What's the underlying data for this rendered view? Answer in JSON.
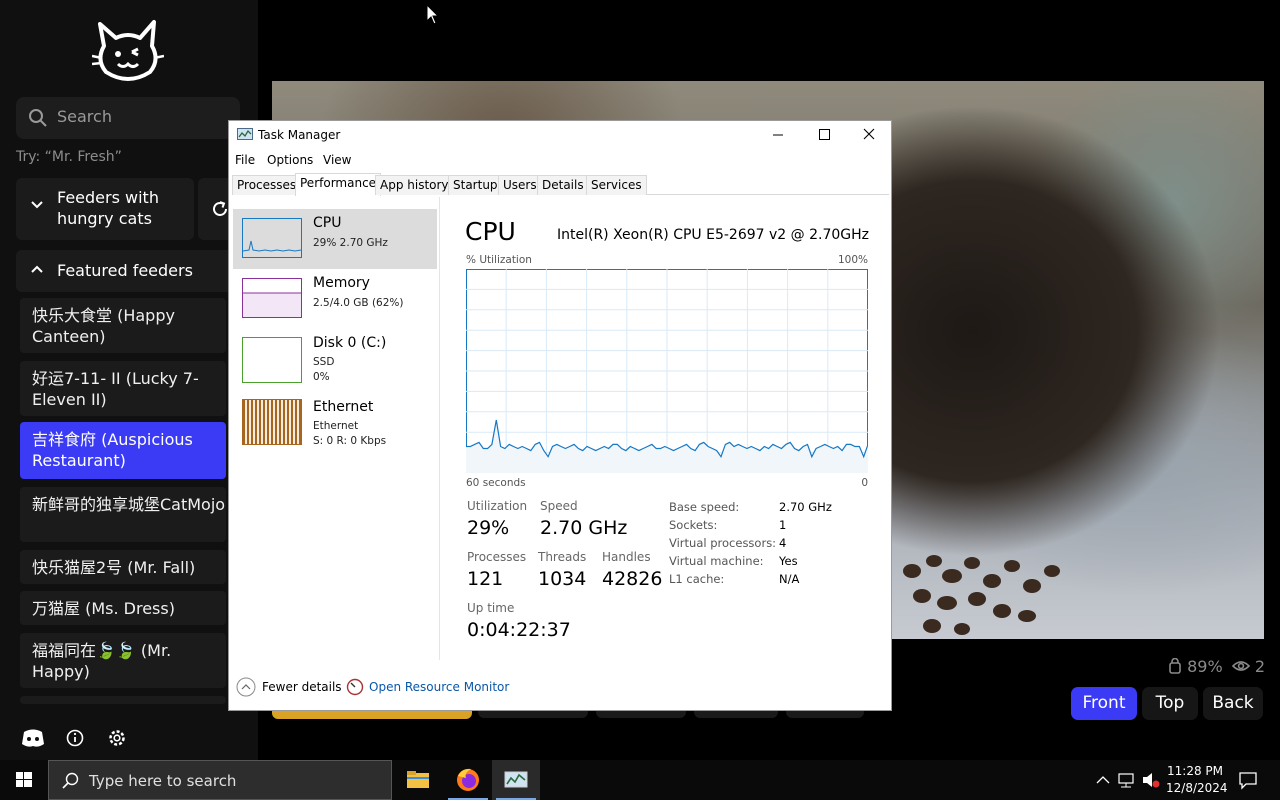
{
  "app": {
    "search_placeholder": "Search",
    "search_hint": "Try: “Mr. Fresh”",
    "group_hungry_label": "Feeders with hungry cats",
    "group_featured_label": "Featured feeders",
    "feeders": [
      {
        "label": "快乐大食堂 (Happy Canteen)"
      },
      {
        "label": "好运7-11- II  (Lucky 7-Eleven II)"
      },
      {
        "label": "吉祥食府 (Auspicious Restaurant)",
        "active": true
      },
      {
        "label": "新鲜哥的独享城堡CatMojo (Mr. Fresh)"
      },
      {
        "label": "快乐猫屋2号 (Mr. Fall)"
      },
      {
        "label": "万猫屋 (Ms. Dress)"
      },
      {
        "label": "福福同在🍃🍃 (Mr. Happy)"
      }
    ],
    "bottom_icons": [
      "discord-icon",
      "info-icon",
      "settings-icon"
    ],
    "accent_color": "#3b3bf5"
  },
  "video": {
    "battery_text": "89%",
    "viewers_text": "2",
    "camera_buttons": {
      "front": "Front",
      "top": "Top",
      "back": "Back"
    },
    "selected_camera": "Front"
  },
  "task_manager": {
    "title": "Task Manager",
    "menu": {
      "file": "File",
      "options": "Options",
      "view": "View"
    },
    "tabs": [
      "Processes",
      "Performance",
      "App history",
      "Startup",
      "Users",
      "Details",
      "Services"
    ],
    "active_tab": "Performance",
    "resources": {
      "cpu": {
        "name": "CPU",
        "sub1": "29%  2.70 GHz"
      },
      "memory": {
        "name": "Memory",
        "sub1": "2.5/4.0 GB (62%)"
      },
      "disk": {
        "name": "Disk 0 (C:)",
        "sub1": "SSD",
        "sub2": "0%"
      },
      "ethernet": {
        "name": "Ethernet",
        "sub1": "Ethernet",
        "sub2": "S: 0  R: 0 Kbps"
      }
    },
    "cpu": {
      "title": "CPU",
      "model": "Intel(R) Xeon(R) CPU E5-2697 v2 @ 2.70GHz",
      "util_label": "% Utilization",
      "util_max": "100%",
      "graph_left": "60 seconds",
      "graph_right": "0",
      "utilization_label": "Utilization",
      "utilization": "29%",
      "speed_label": "Speed",
      "speed": "2.70 GHz",
      "processes_label": "Processes",
      "processes": "121",
      "threads_label": "Threads",
      "threads": "1034",
      "handles_label": "Handles",
      "handles": "42826",
      "uptime_label": "Up time",
      "uptime": "0:04:22:37",
      "specs": [
        {
          "k": "Base speed:",
          "v": "2.70 GHz"
        },
        {
          "k": "Sockets:",
          "v": "1"
        },
        {
          "k": "Virtual processors:",
          "v": "4"
        },
        {
          "k": "Virtual machine:",
          "v": "Yes"
        },
        {
          "k": "L1 cache:",
          "v": "N/A"
        }
      ],
      "history_percent": [
        13,
        13,
        14,
        15,
        12,
        12,
        14,
        26,
        13,
        12,
        14,
        13,
        12,
        13,
        12,
        11,
        14,
        15,
        11,
        8,
        13,
        14,
        13,
        12,
        13,
        14,
        12,
        11,
        13,
        12,
        11,
        12,
        13,
        12,
        14,
        14,
        12,
        11,
        13,
        12,
        11,
        12,
        13,
        14,
        12,
        12,
        13,
        12,
        11,
        12,
        13,
        14,
        12,
        11,
        14,
        15,
        13,
        12,
        11,
        8,
        14,
        15,
        13,
        14,
        13,
        12,
        13,
        12,
        11,
        13,
        12,
        14,
        13,
        12,
        14,
        15,
        12,
        11,
        13,
        14,
        8,
        12,
        13,
        14,
        13,
        12,
        13,
        11,
        14,
        14,
        13,
        13,
        8,
        14
      ],
      "graph_color": "#1778c4"
    },
    "footer": {
      "fewer": "Fewer details",
      "monitor": "Open Resource Monitor"
    }
  },
  "taskbar": {
    "search_placeholder": "Type here to search",
    "apps": [
      "file-explorer-icon",
      "firefox-icon",
      "task-manager-icon"
    ],
    "time": "11:28 PM",
    "date": "12/8/2024"
  }
}
